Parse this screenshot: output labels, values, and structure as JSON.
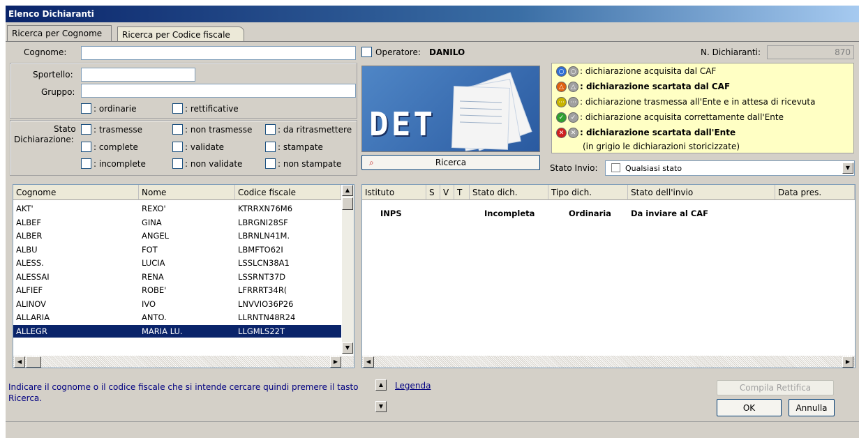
{
  "window": {
    "title": "Elenco Dichiaranti"
  },
  "tabs": [
    {
      "label": "Ricerca per Cognome"
    },
    {
      "label": "Ricerca per Codice fiscale"
    }
  ],
  "form": {
    "cognome_label": "Cognome:",
    "cognome_value": "",
    "operatore_label": "Operatore:",
    "operatore_value": "DANILO",
    "n_dichiaranti_label": "N. Dichiaranti:",
    "n_dichiaranti_value": "870",
    "sportello_label": "Sportello:",
    "gruppo_label": "Gruppo:",
    "ordinarie_label": ": ordinarie",
    "rettificative_label": ": rettificative",
    "stato_label": "Stato\nDichiarazione:",
    "stato_label_1": "Stato",
    "stato_label_2": "Dichiarazione:",
    "checks": {
      "trasmesse": ": trasmesse",
      "non_trasmesse": ": non trasmesse",
      "da_ritrasmettere": ": da ritrasmettere",
      "complete": ": complete",
      "validate": ": validate",
      "stampate": ": stampate",
      "incomplete": ": incomplete",
      "non_validate": ": non validate",
      "non_stampate": ": non stampate"
    },
    "logo_text": "DET",
    "ricerca_button": "Ricerca",
    "stato_invio_label": "Stato Invio:",
    "stato_invio_value": "Qualsiasi stato"
  },
  "legend": {
    "rows": [
      {
        "text": ": dichiarazione acquisita dal CAF",
        "bold": false,
        "color": "#2f6fd6"
      },
      {
        "text": ": dichiarazione scartata dal CAF",
        "bold": true,
        "color": "#e06010"
      },
      {
        "text": ": dichiarazione trasmessa all'Ente e in attesa di ricevuta",
        "bold": false,
        "color": "#c8b400"
      },
      {
        "text": ": dichiarazione acquisita correttamente dall'Ente",
        "bold": false,
        "color": "#2fa02f"
      },
      {
        "text": ": dichiarazione scartata dall'Ente",
        "bold": true,
        "color": "#d02020"
      }
    ],
    "note": "(in grigio le dichiarazioni storicizzate)"
  },
  "left_table": {
    "headers": [
      "Cognome",
      "Nome",
      "Codice fiscale"
    ],
    "rows": [
      [
        "AKT'",
        "REXO'",
        "KTRRXN76M6"
      ],
      [
        "ALBEF",
        "GINA",
        "LBRGNI28SF"
      ],
      [
        "ALBER",
        "ANGEL",
        "LBRNLN41M."
      ],
      [
        "ALBU",
        "FOT",
        "LBMFTO62I"
      ],
      [
        "ALESS.",
        "LUCIA",
        "LSSLCN38A1"
      ],
      [
        "ALESSAI",
        "RENA",
        "LSSRNT37D"
      ],
      [
        "ALFIEF",
        "ROBE'",
        "LFRRRT34R("
      ],
      [
        "ALINOV",
        "IVO",
        "LNVVIO36P26"
      ],
      [
        "ALLARIA",
        "ANTO.",
        "LLRNTN48R24"
      ],
      [
        "ALLEGR",
        "MARIA LU.",
        "LLGMLS22T"
      ]
    ],
    "selected_index": 9
  },
  "right_table": {
    "headers": [
      "Istituto",
      "S",
      "V",
      "T",
      "Stato dich.",
      "Tipo dich.",
      "Stato dell'invio",
      "Data pres."
    ],
    "rows": [
      [
        "INPS",
        "",
        "",
        "",
        "Incompleta",
        "Ordinaria",
        "Da inviare al CAF",
        ""
      ]
    ]
  },
  "footer": {
    "hint": "Indicare il cognome o il codice fiscale che si intende cercare quindi premere il tasto Ricerca.",
    "hint_line1": "Indicare il cognome o il codice fiscale che si intende cercare quindi premere il tasto",
    "hint_line2": "Ricerca.",
    "legenda_link": "Legenda",
    "compila_rettifica": "Compila Rettifica",
    "ok": "OK",
    "annulla": "Annulla"
  }
}
